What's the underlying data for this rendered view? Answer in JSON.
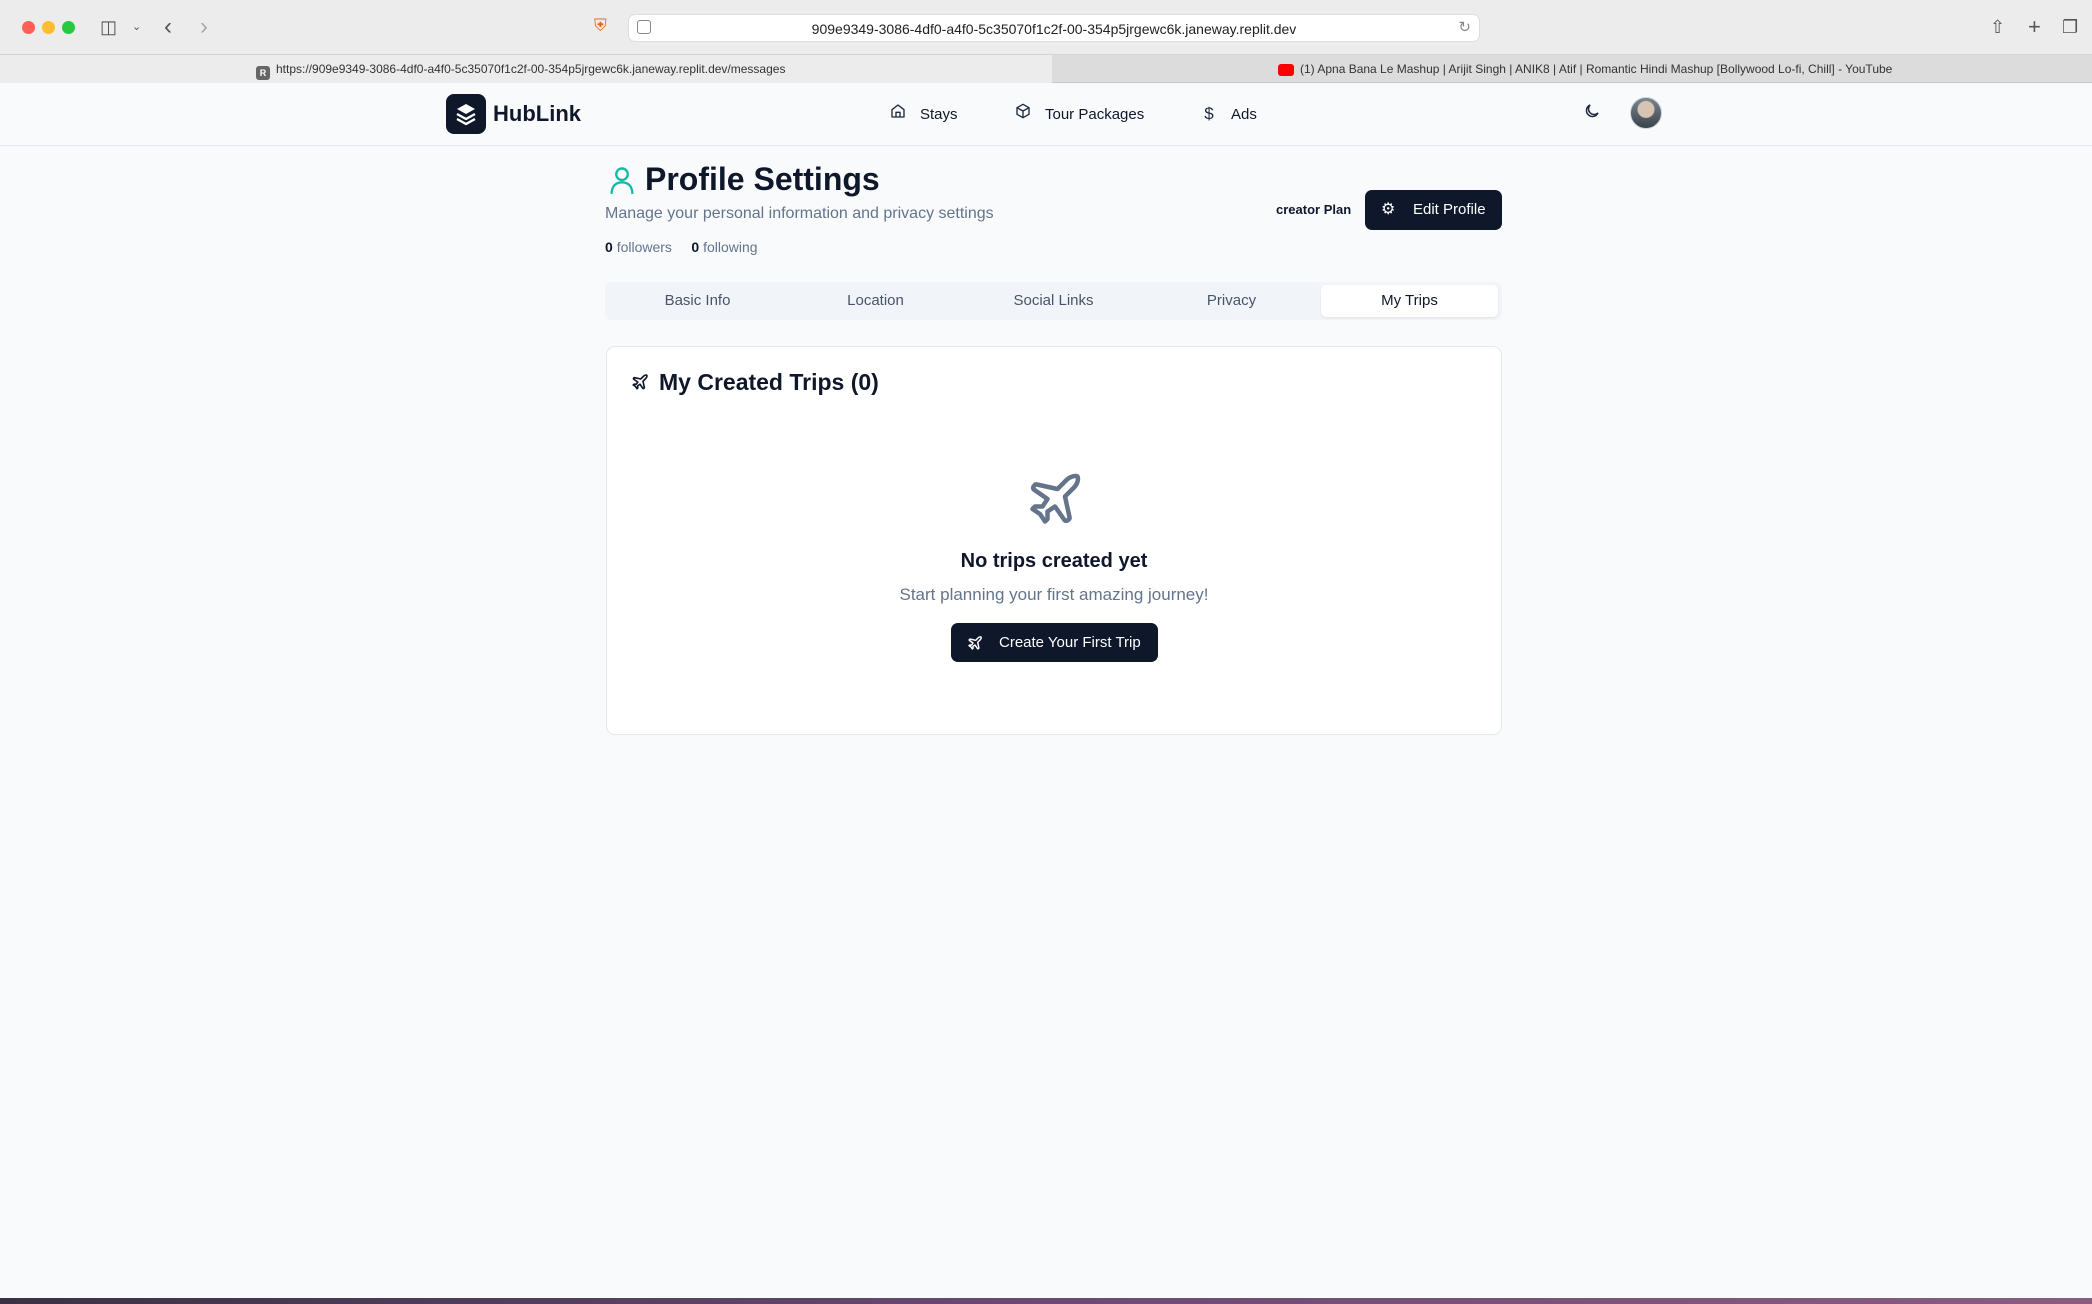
{
  "browser": {
    "address": "909e9349-3086-4df0-a4f0-5c35070f1c2f-00-354p5jrgewc6k.janeway.replit.dev",
    "tabs": [
      {
        "title": "https://909e9349-3086-4df0-a4f0-5c35070f1c2f-00-354p5jrgewc6k.janeway.replit.dev/messages",
        "favicon": "R"
      },
      {
        "title": "(1) Apna Bana Le Mashup | Arijit Singh | ANIK8 | Atif | Romantic Hindi Mashup [Bollywood Lo-fi, Chill] - YouTube"
      }
    ]
  },
  "header": {
    "brand": "HubLink",
    "nav": [
      {
        "label": "Stays",
        "icon": "home-icon"
      },
      {
        "label": "Tour Packages",
        "icon": "package-icon"
      },
      {
        "label": "Ads",
        "icon": "dollar-icon"
      }
    ]
  },
  "profile": {
    "title": "Profile Settings",
    "subtitle": "Manage your personal information and privacy settings",
    "followers_count": "0",
    "followers_label": "followers",
    "following_count": "0",
    "following_label": "following",
    "plan": "creator Plan",
    "edit_label": "Edit Profile"
  },
  "tabs": [
    "Basic Info",
    "Location",
    "Social Links",
    "Privacy",
    "My Trips"
  ],
  "active_tab": "My Trips",
  "trips": {
    "title": "My Created Trips (0)",
    "empty_title": "No trips created yet",
    "empty_subtitle": "Start planning your first amazing journey!",
    "create_label": "Create Your First Trip"
  },
  "colors": {
    "primary": "#0f172a",
    "accent": "#14b8a6",
    "muted": "#64748b"
  }
}
